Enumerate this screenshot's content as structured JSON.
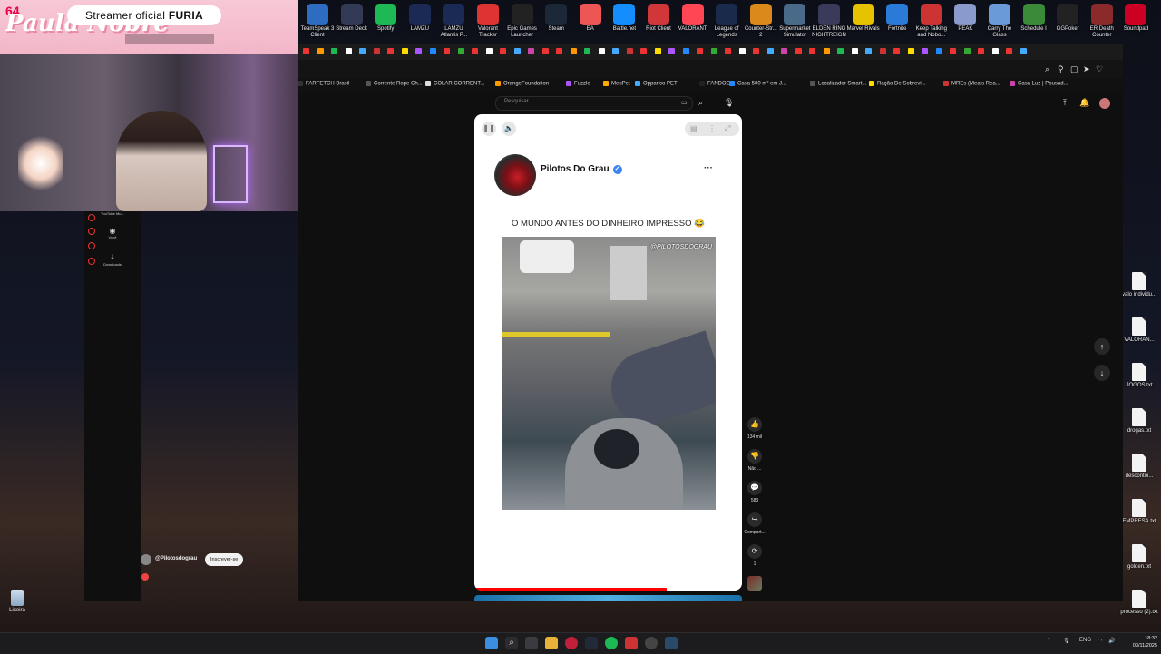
{
  "desktop_icons": [
    {
      "label": "TeamSpeak 3 Client",
      "icon": "teamspeak-icon",
      "color": "#2d6cc0"
    },
    {
      "label": "Stream Deck",
      "icon": "streamdeck-icon",
      "color": "#333a55"
    },
    {
      "label": "Spotify",
      "icon": "spotify-icon",
      "color": "#1db954"
    },
    {
      "label": "LAMZU",
      "icon": "lamzu-icon",
      "color": "#1a2a55"
    },
    {
      "label": "LAMZU Atlantis P...",
      "icon": "lamzu-icon",
      "color": "#1a2a55"
    },
    {
      "label": "Valorant Tracker",
      "icon": "tracker-icon",
      "color": "#d33"
    },
    {
      "label": "Epic Games Launcher",
      "icon": "epic-icon",
      "color": "#222"
    },
    {
      "label": "Steam",
      "icon": "steam-icon",
      "color": "#1b2838"
    },
    {
      "label": "EA",
      "icon": "ea-icon",
      "color": "#e55"
    },
    {
      "label": "Battle.net",
      "icon": "battlenet-icon",
      "color": "#148eff"
    },
    {
      "label": "Riot Client",
      "icon": "riot-icon",
      "color": "#d13639"
    },
    {
      "label": "VALORANT",
      "icon": "valorant-icon",
      "color": "#ff4655"
    },
    {
      "label": "League of Legends",
      "icon": "lol-icon",
      "color": "#1a2a4a"
    },
    {
      "label": "Counter-Str... 2",
      "icon": "cs2-icon",
      "color": "#d98a1a"
    },
    {
      "label": "Supermarket Simulator",
      "icon": "supermarket-icon",
      "color": "#4a6a8a"
    },
    {
      "label": "ELDEN RING NIGHTREIGN",
      "icon": "eldenring-icon",
      "color": "#3a3a5a"
    },
    {
      "label": "Marvel Rivals",
      "icon": "marvel-icon",
      "color": "#e6c200"
    },
    {
      "label": "Fortnite",
      "icon": "fortnite-icon",
      "color": "#2a7ad8"
    },
    {
      "label": "Keep Talking and Nobo...",
      "icon": "keeptalking-icon",
      "color": "#c33"
    },
    {
      "label": "PEAK",
      "icon": "peak-icon",
      "color": "#8a9acc"
    },
    {
      "label": "Carry The Glass",
      "icon": "carryglass-icon",
      "color": "#6a9ad8"
    },
    {
      "label": "Schedule I",
      "icon": "schedule-icon",
      "color": "#3a8a3a"
    },
    {
      "label": "GGPoker",
      "icon": "ggpoker-icon",
      "color": "#222"
    },
    {
      "label": "ER Death Counter",
      "icon": "counter-icon",
      "color": "#8a2a2a"
    },
    {
      "label": "Soundpad",
      "icon": "soundpad-icon",
      "color": "#c02"
    }
  ],
  "desktop_files": [
    {
      "label": "valo individu..."
    },
    {
      "label": "VALORAN..."
    },
    {
      "label": "JOGOS.txt"
    },
    {
      "label": "drogas.txt"
    },
    {
      "label": "descontoi..."
    },
    {
      "label": "EMPRESA.txt"
    },
    {
      "label": "golden.txt"
    },
    {
      "label": "processo (2).txt"
    }
  ],
  "webcam": {
    "counter": "64",
    "logo": "Paula Nobre",
    "banner_prefix": "Streamer oficial ",
    "banner_brand": "FURIA"
  },
  "bookmarks": [
    {
      "label": "FARFETCH Brasil",
      "color": "#333"
    },
    {
      "label": "Corrente Rope Ch...",
      "color": "#555"
    },
    {
      "label": "COLAR CORRENT...",
      "color": "#ddd"
    },
    {
      "label": "OrangeFoundation",
      "color": "#f90"
    },
    {
      "label": "Fuzzle",
      "color": "#a5f"
    },
    {
      "label": "MeuPet",
      "color": "#fa0"
    },
    {
      "label": "Opparico PET",
      "color": "#4af"
    },
    {
      "label": "FANDOG",
      "color": "#222"
    },
    {
      "label": "Casa 500 m² em J...",
      "color": "#28f"
    },
    {
      "label": "Localizador Smart...",
      "color": "#555"
    },
    {
      "label": "Ração De Sobrevi...",
      "color": "#fd0"
    },
    {
      "label": "MREs (Meals Rea...",
      "color": "#c33"
    },
    {
      "label": "Casa Luz | Pousad...",
      "color": "#c4a"
    }
  ],
  "youtube": {
    "search_placeholder": "Pesquisar",
    "sidebar": [
      {
        "label": "YouTube Mu..."
      },
      {
        "label": "Você"
      },
      {
        "label": "Downloads"
      }
    ]
  },
  "short": {
    "author": "Pilotos Do Grau",
    "caption": "O MUNDO ANTES DO DINHEIRO IMPRESSO 😂",
    "watermark": "@PILOTOSDOGRAU",
    "progress": 0.72
  },
  "actions": {
    "likes": "134 mil",
    "dislike": "Não ...",
    "comments": "583",
    "share": "Compart...",
    "remix": "1"
  },
  "channel": {
    "handle": "@Pilotosdograu",
    "subscribe": "Inscrever-se"
  },
  "recycle_bin": "Lixeira",
  "taskbar": {
    "lang": "ENG",
    "time": "18:32",
    "date": "03/11/2025"
  }
}
